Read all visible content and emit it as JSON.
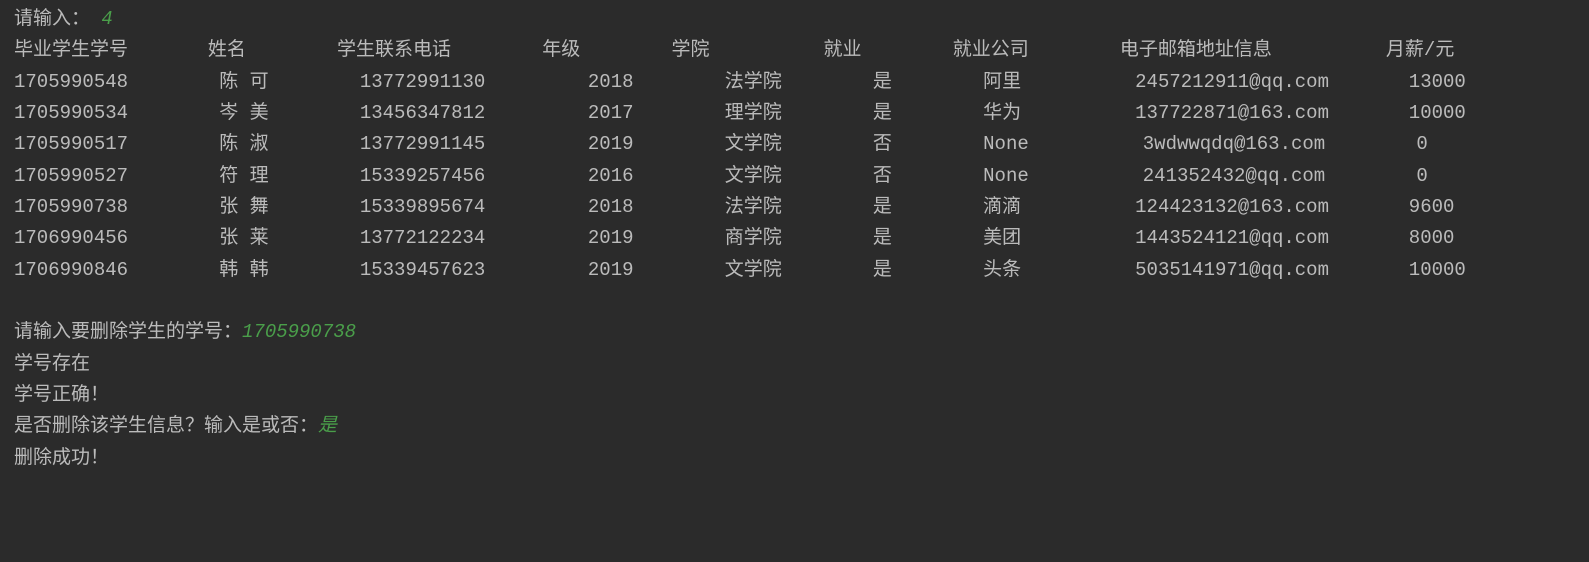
{
  "prompt1": {
    "label": "请输入：",
    "value": "4"
  },
  "headers": {
    "col0": "毕业学生学号",
    "col1": "姓名",
    "col2": "学生联系电话",
    "col3": "年级",
    "col4": "学院",
    "col5": "就业",
    "col6": "就业公司",
    "col7": "电子邮箱地址信息",
    "col8": "月薪/元"
  },
  "rows": [
    {
      "id": "1705990548",
      "name": "陈 可",
      "phone": "13772991130",
      "year": "2018",
      "college": "法学院",
      "employed": "是",
      "company": "阿里",
      "email": "2457212911@qq.com",
      "salary": "13000"
    },
    {
      "id": "1705990534",
      "name": "岑 美",
      "phone": "13456347812",
      "year": "2017",
      "college": "理学院",
      "employed": "是",
      "company": "华为",
      "email": "137722871@163.com",
      "salary": "10000"
    },
    {
      "id": "1705990517",
      "name": "陈 淑",
      "phone": "13772991145",
      "year": "2019",
      "college": "文学院",
      "employed": "否",
      "company": "None",
      "email": "3wdwwqdq@163.com",
      "salary": "0"
    },
    {
      "id": "1705990527",
      "name": "符 理",
      "phone": "15339257456",
      "year": "2016",
      "college": "文学院",
      "employed": "否",
      "company": "None",
      "email": "241352432@qq.com",
      "salary": "0"
    },
    {
      "id": "1705990738",
      "name": "张 舞",
      "phone": "15339895674",
      "year": "2018",
      "college": "法学院",
      "employed": "是",
      "company": "滴滴",
      "email": "124423132@163.com",
      "salary": "9600"
    },
    {
      "id": "1706990456",
      "name": "张 莱",
      "phone": "13772122234",
      "year": "2019",
      "college": "商学院",
      "employed": "是",
      "company": "美团",
      "email": "1443524121@qq.com",
      "salary": "8000"
    },
    {
      "id": "1706990846",
      "name": "韩 韩",
      "phone": "15339457623",
      "year": "2019",
      "college": "文学院",
      "employed": "是",
      "company": "头条",
      "email": "5035141971@qq.com",
      "salary": "10000"
    }
  ],
  "prompt2": {
    "label": "请输入要删除学生的学号：",
    "value": "1705990738"
  },
  "msg_exists": "学号存在",
  "msg_correct": "学号正确！",
  "prompt3": {
    "label": "是否删除该学生信息？输入是或否：",
    "value": "是"
  },
  "msg_success": "删除成功！"
}
